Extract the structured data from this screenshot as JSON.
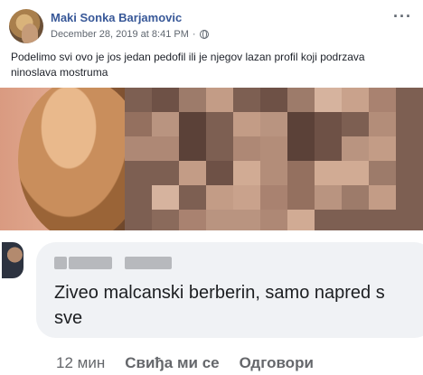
{
  "post": {
    "author": "Maki Sonka Barjamovic",
    "timestamp": "December 28, 2019 at 8:41 PM",
    "separator": "·",
    "more_icon": "more-options-icon",
    "privacy_icon": "globe-icon",
    "text": "Podelimo svi ovo je jos jedan pedofil ili je njegov lazan profil koji podrzava ninoslava mostruma"
  },
  "comment": {
    "text_line1": "Ziveo malcanski berberin, samo napred s",
    "text_line2": "sve",
    "time": "12 мин",
    "like_label": "Свиђа ми се",
    "reply_label": "Одговори"
  },
  "colors": {
    "author_link": "#385898",
    "bubble_bg": "#f0f2f5",
    "meta_gray": "#606770"
  }
}
